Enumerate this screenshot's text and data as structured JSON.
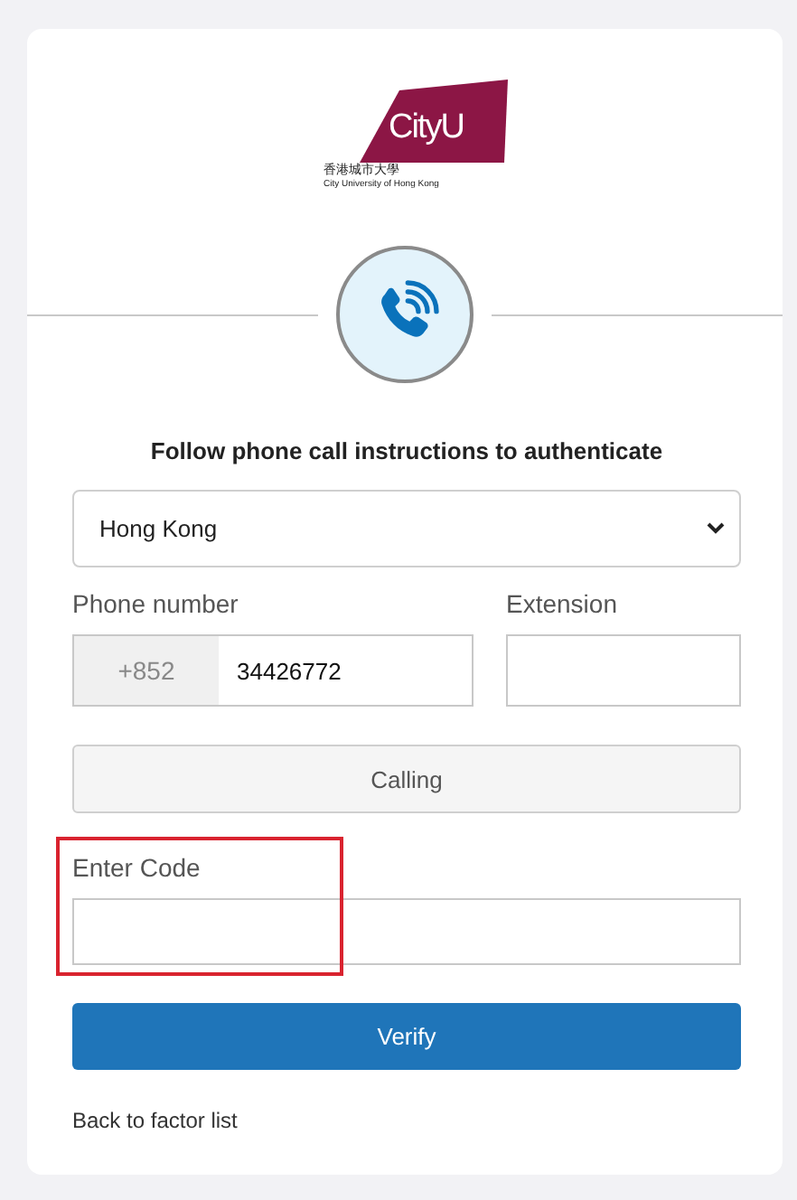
{
  "logo": {
    "wordmark": "CityU",
    "chinese_name": "香港城市大學",
    "english_name": "City University of Hong Kong"
  },
  "title": "Follow phone call instructions to authenticate",
  "country_select": {
    "value": "Hong Kong"
  },
  "phone": {
    "label": "Phone number",
    "prefix": "+852",
    "value": "34426772"
  },
  "extension": {
    "label": "Extension"
  },
  "call_button": {
    "label": "Calling",
    "disabled": true
  },
  "code": {
    "label": "Enter Code",
    "highlighted": true
  },
  "verify_button": {
    "label": "Verify"
  },
  "back_link": "Back to factor list"
}
